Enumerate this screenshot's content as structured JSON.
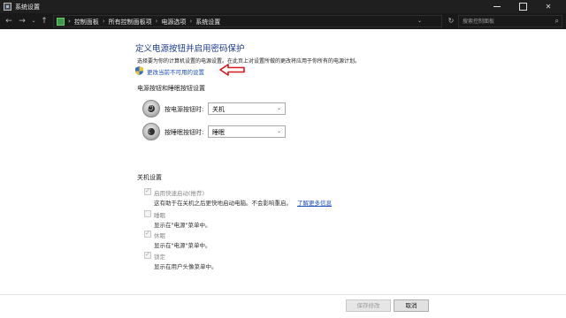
{
  "window": {
    "title": "系统设置",
    "icon": "settings-window-icon",
    "controls": [
      "minimize-icon",
      "maximize-icon",
      "close-icon"
    ]
  },
  "addressbar": {
    "back_glyph": "←",
    "forward_glyph": "→",
    "history_glyph": "⌄",
    "up_glyph": "↑",
    "dropdown_glyph": "⌄",
    "refresh_glyph": "↻",
    "breadcrumbs": [
      "控制面板",
      "所有控制面板项",
      "电源选项",
      "系统设置"
    ],
    "separator": "›",
    "search_placeholder": "搜索控制面板",
    "search_glyph": "⌕"
  },
  "main": {
    "title": "定义电源按钮并启用密码保护",
    "description": "选择要为你的计算机设置的电源设置。在此页上对设置所做的更改将应用于你所有的电源计划。",
    "change_link": "更改当前不可用的设置",
    "power_section": {
      "heading": "电源按钮和睡眠按钮设置",
      "power_button_label": "按电源按钮时:",
      "power_button_value": "关机",
      "sleep_button_label": "按睡眠按钮时:",
      "sleep_button_value": "睡眠",
      "select_arrow": "⌄",
      "power_glyph": "⏻",
      "sleep_glyph": "☾"
    },
    "shutdown_section": {
      "heading": "关机设置",
      "options": [
        {
          "label": "启用快速启动(推荐)",
          "checked": true,
          "description": "这有助于在关机之后更快地启动电脑。不会影响重启。",
          "link": "了解更多信息"
        },
        {
          "label": "睡眠",
          "checked": false,
          "description": "显示在\"电源\"菜单中。"
        },
        {
          "label": "休眠",
          "checked": true,
          "description": "显示在\"电源\"菜单中。"
        },
        {
          "label": "锁定",
          "checked": true,
          "description": "显示在用户头像菜单中。"
        }
      ]
    }
  },
  "footer": {
    "save_label": "保存修改",
    "cancel_label": "取消"
  },
  "colors": {
    "title_blue": "#1c3b8f",
    "link_blue": "#1a4fbf",
    "annotation_red": "#d6191f",
    "titlebar_bg": "#1f1f1f"
  }
}
